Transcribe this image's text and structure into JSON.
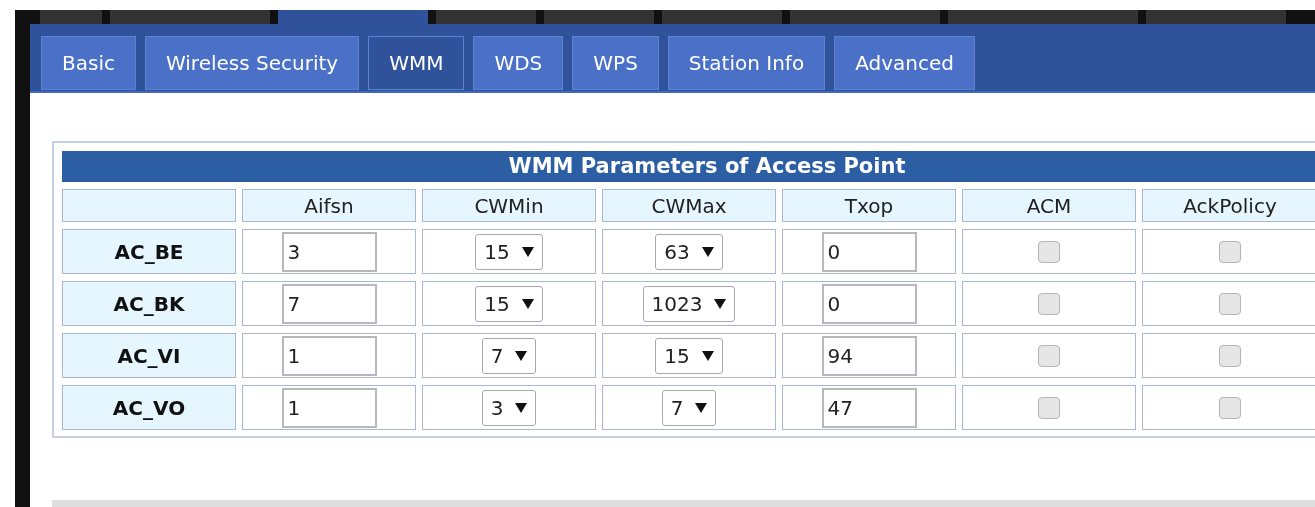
{
  "top_nav": [
    {
      "selected": false
    },
    {
      "selected": false
    },
    {
      "selected": true
    },
    {
      "selected": false
    },
    {
      "selected": false
    },
    {
      "selected": false
    },
    {
      "selected": false
    },
    {
      "selected": false
    },
    {
      "selected": false
    }
  ],
  "tabs": [
    {
      "label": "Basic",
      "selected": false
    },
    {
      "label": "Wireless Security",
      "selected": false
    },
    {
      "label": "WMM",
      "selected": true
    },
    {
      "label": "WDS",
      "selected": false
    },
    {
      "label": "WPS",
      "selected": false
    },
    {
      "label": "Station Info",
      "selected": false
    },
    {
      "label": "Advanced",
      "selected": false
    }
  ],
  "table": {
    "title": "WMM Parameters of Access Point",
    "columns": [
      "Aifsn",
      "CWMin",
      "CWMax",
      "Txop",
      "ACM",
      "AckPolicy"
    ],
    "rows": [
      {
        "name": "AC_BE",
        "aifsn": "3",
        "cwmin": "15",
        "cwmax": "63",
        "txop": "0",
        "acm": false,
        "ack_policy": false
      },
      {
        "name": "AC_BK",
        "aifsn": "7",
        "cwmin": "15",
        "cwmax": "1023",
        "txop": "0",
        "acm": false,
        "ack_policy": false
      },
      {
        "name": "AC_VI",
        "aifsn": "1",
        "cwmin": "7",
        "cwmax": "15",
        "txop": "94",
        "acm": false,
        "ack_policy": false
      },
      {
        "name": "AC_VO",
        "aifsn": "1",
        "cwmin": "3",
        "cwmax": "7",
        "txop": "47",
        "acm": false,
        "ack_policy": false
      }
    ]
  }
}
